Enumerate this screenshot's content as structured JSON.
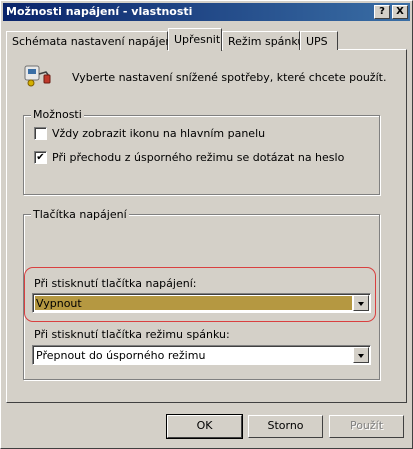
{
  "window": {
    "title": "Možnosti napájení - vlastnosti",
    "help_glyph": "?",
    "close_glyph": "X"
  },
  "tabs": [
    {
      "label": "Schémata nastavení napájení",
      "active": false
    },
    {
      "label": "Upřesnit",
      "active": true
    },
    {
      "label": "Režim spánku",
      "active": false
    },
    {
      "label": "UPS",
      "active": false
    }
  ],
  "intro": {
    "icon": "power-options-icon",
    "text": "Vyberte nastavení snížené spotřeby, které chcete použít."
  },
  "options_group": {
    "title": "Možnosti",
    "items": [
      {
        "label": "Vždy zobrazit ikonu na hlavním panelu",
        "checked": false
      },
      {
        "label": "Při přechodu z úsporného režimu se dotázat na heslo",
        "checked": true
      }
    ]
  },
  "power_buttons_group": {
    "title": "Tlačítka napájení",
    "power_button": {
      "label": "Při stisknutí tlačítka napájení:",
      "value": "Vypnout"
    },
    "sleep_button": {
      "label": "Při stisknutí tlačítka režimu spánku:",
      "value": "Přepnout do úsporného režimu"
    }
  },
  "buttons": {
    "ok": "OK",
    "cancel": "Storno",
    "apply": "Použít"
  },
  "colors": {
    "highlight_ring": "#d94040",
    "selection_fill": "#b59841"
  }
}
